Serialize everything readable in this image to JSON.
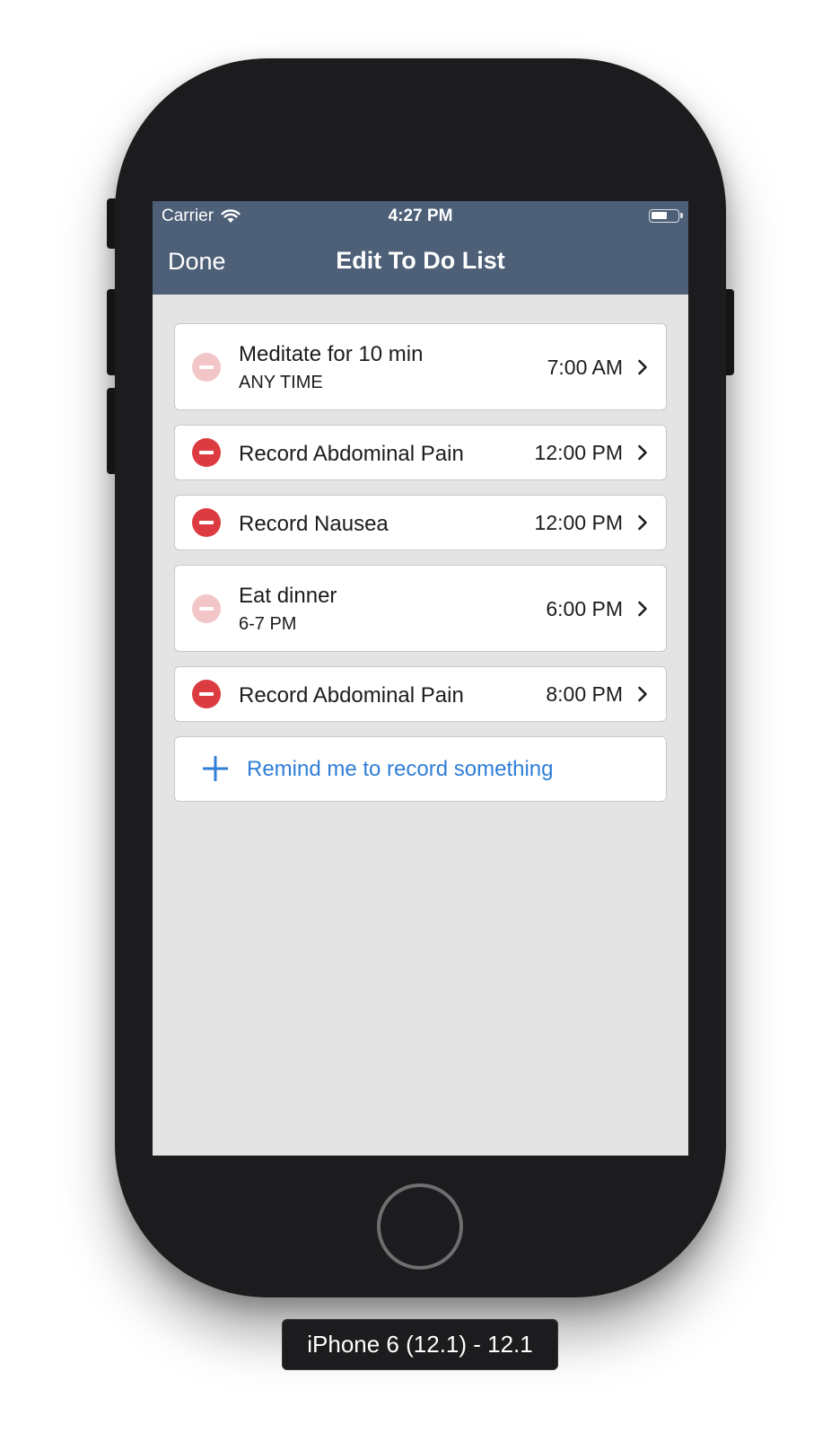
{
  "status_bar": {
    "carrier": "Carrier",
    "time": "4:27 PM",
    "wifi_icon": "wifi-icon",
    "battery_icon": "battery-icon"
  },
  "nav": {
    "done_label": "Done",
    "title": "Edit To Do List"
  },
  "todo_items": [
    {
      "title": "Meditate for 10 min",
      "subtitle": "ANY TIME",
      "time": "7:00 AM",
      "delete_enabled": false
    },
    {
      "title": "Record Abdominal Pain",
      "subtitle": "",
      "time": "12:00 PM",
      "delete_enabled": true
    },
    {
      "title": "Record Nausea",
      "subtitle": "",
      "time": "12:00 PM",
      "delete_enabled": true
    },
    {
      "title": "Eat dinner",
      "subtitle": "6-7 PM",
      "time": "6:00 PM",
      "delete_enabled": false
    },
    {
      "title": "Record Abdominal Pain",
      "subtitle": "",
      "time": "8:00 PM",
      "delete_enabled": true
    }
  ],
  "add_reminder": {
    "label": "Remind me to record something"
  },
  "device_label": "iPhone 6 (12.1) - 12.1",
  "colors": {
    "nav_background": "#4d6078",
    "screen_background": "#e4e4e4",
    "delete_active": "#dc3b41",
    "delete_disabled": "#f2c5c7",
    "accent_blue": "#2f7ed8",
    "phone_body": "#1c1c1e"
  }
}
